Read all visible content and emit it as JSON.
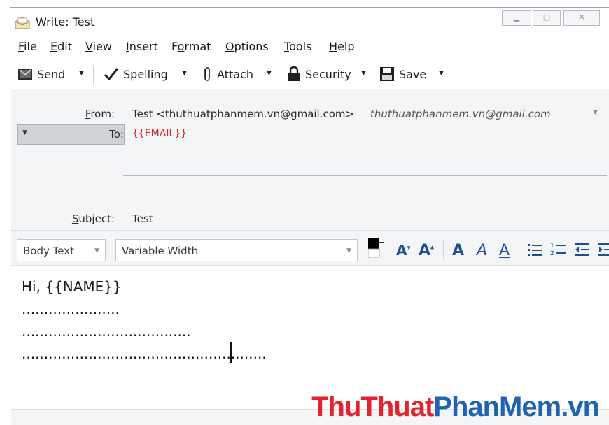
{
  "window": {
    "title": "Write: Test"
  },
  "menu": [
    "File",
    "Edit",
    "View",
    "Insert",
    "Format",
    "Options",
    "Tools",
    "Help"
  ],
  "toolbar": {
    "send": "Send",
    "spelling": "Spelling",
    "attach": "Attach",
    "security": "Security",
    "save": "Save"
  },
  "header": {
    "from_label": "From:",
    "from_value": "Test <thuthuatphanmem.vn@gmail.com>",
    "from_alias": "thuthuatphanmem.vn@gmail.com",
    "to_label": "To:",
    "to_value": "{{EMAIL}}",
    "subject_label": "Subject:",
    "subject_value": "Test"
  },
  "format": {
    "paragraph_style": "Body Text",
    "font": "Variable Width"
  },
  "body_lines": [
    "Hi, {{NAME}}",
    "......................",
    "......................................",
    "......................................................."
  ],
  "watermark": {
    "part1": "ThuThuat",
    "part2": "PhanMem",
    "part3": ".vn"
  },
  "colors": {
    "accent_blue": "#1d4f91",
    "to_value_red": "#d4262a",
    "watermark_red": "#e3232f",
    "watermark_blue": "#1f63b5"
  },
  "icons": [
    "app-icon",
    "send-icon",
    "checkmark-icon",
    "paperclip-icon",
    "lock-icon",
    "floppy-disk-icon",
    "text-color-icon",
    "font-smaller-icon",
    "font-larger-icon",
    "bold-icon",
    "italic-icon",
    "underline-icon",
    "bullet-list-icon",
    "numbered-list-icon",
    "outdent-icon",
    "indent-icon"
  ]
}
